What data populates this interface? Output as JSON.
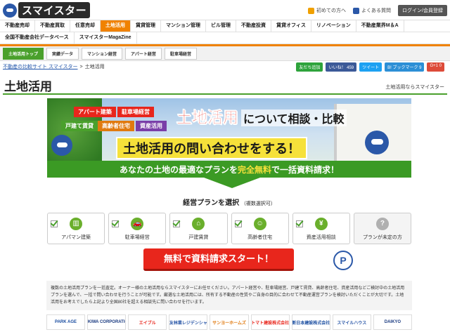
{
  "header": {
    "logo_text": "スマイスター",
    "links": [
      {
        "label": "初めての方へ",
        "color": "#f0a000"
      },
      {
        "label": "よくある質問",
        "color": "#2b58a8"
      }
    ],
    "login_label": "ログイン/会員登録"
  },
  "nav": {
    "row1": [
      "不動産売却",
      "不動産買取",
      "任意売却",
      "土地活用",
      "賃貸管理",
      "マンション管理",
      "ビル管理",
      "不動産投資",
      "賃貸オフィス",
      "リノベーション",
      "不動産業界M＆A"
    ],
    "row2": [
      "全国不動産会社データベース",
      "スマイスターMagaZine"
    ],
    "active": "土地活用"
  },
  "subnav": [
    "土地活用トップ",
    "実績データ",
    "マンション経営",
    "アパート経営",
    "駐車場経営"
  ],
  "breadcrumb": {
    "home": "不動産の比較サイト スマイスター",
    "sep": ">",
    "current": "土地活用"
  },
  "social": [
    {
      "label": "友だち追加",
      "color": "#2ea33b"
    },
    {
      "label": "いいね！ 459",
      "color": "#3b5998"
    },
    {
      "label": "ツイート",
      "color": "#1da1f2"
    },
    {
      "label": "B! ブックマーク 9",
      "color": "#2c8fd6"
    },
    {
      "label": "G+1 0",
      "color": "#dd4b39"
    }
  ],
  "page": {
    "title": "土地活用",
    "subtitle": "土地活用ならスマイスター"
  },
  "hero": {
    "tags": [
      {
        "label": "アパート建築",
        "color": "#e8261c"
      },
      {
        "label": "駐車場経営",
        "color": "#e8261c"
      },
      {
        "label": "戸建て賃貸",
        "color": "#4aa02c"
      },
      {
        "label": "高齢者住宅",
        "color": "#e07a10"
      },
      {
        "label": "資産活用",
        "color": "#7a3ea8"
      }
    ],
    "title_red": "土地活用",
    "title_rest": "について相談・比較",
    "banner": "土地活用の問い合わせをする！",
    "band_pre": "あなたの土地の最適なプランを",
    "band_highlight": "完全無料",
    "band_post": "で一括資料請求！"
  },
  "selection": {
    "title": "経営プランを選択",
    "note": "（複数選択可）",
    "plans": [
      {
        "label": "アパマン建築",
        "icon": "building-icon",
        "glyph": "▥"
      },
      {
        "label": "駐車場経営",
        "icon": "car-icon",
        "glyph": "🚗"
      },
      {
        "label": "戸建賃貸",
        "icon": "house-icon",
        "glyph": "⌂"
      },
      {
        "label": "高齢者住宅",
        "icon": "elderly-icon",
        "glyph": "☺"
      },
      {
        "label": "資産活用相談",
        "icon": "money-bag-icon",
        "glyph": "¥"
      },
      {
        "label": "プランが未定の方",
        "icon": "question-icon",
        "glyph": "?"
      }
    ]
  },
  "cta": {
    "label": "無料で資料請求スタート！"
  },
  "privacy_mark": "P",
  "notice": "複数の土地活用プランを一括査定。オーナー様の土地活用ならスマイスターにお任せください。アパート経営や、駐車場経営、戸建て賃貸、高齢者住宅、資産活用などご検討中の土地活用プランを選んで、一括で問い合わせを行うことが可能です。厳選な土地活用には、所有する不動産の性質やご自身の目的に合わせて不動産運営プランを検討いただくことが大切です。土地活用をお考えでしたら上記より全国80社を超える相談先に問い合わせを行います。",
  "partners": [
    "PARK AGE",
    "SEKIWA CORPORATION",
    "エイブル",
    "住友林業レジデンシャル",
    "サンヨーホームズ",
    "トマト建設株式会社",
    "新日本建設株式会社",
    "スマイルハウス",
    "DAIKYO"
  ]
}
